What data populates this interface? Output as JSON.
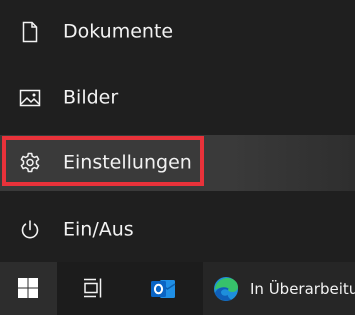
{
  "start_menu": {
    "items": [
      {
        "label": "Dokumente",
        "icon": "document-icon"
      },
      {
        "label": "Bilder",
        "icon": "pictures-icon"
      },
      {
        "label": "Einstellungen",
        "icon": "gear-icon"
      },
      {
        "label": "Ein/Aus",
        "icon": "power-icon"
      }
    ],
    "highlight_color": "#e8323a"
  },
  "taskbar": {
    "start_icon": "windows-logo-icon",
    "taskview_icon": "task-view-icon",
    "outlook_icon": "outlook-icon",
    "edge_icon": "edge-icon",
    "edge_window_label": "In Überarbeitu"
  }
}
